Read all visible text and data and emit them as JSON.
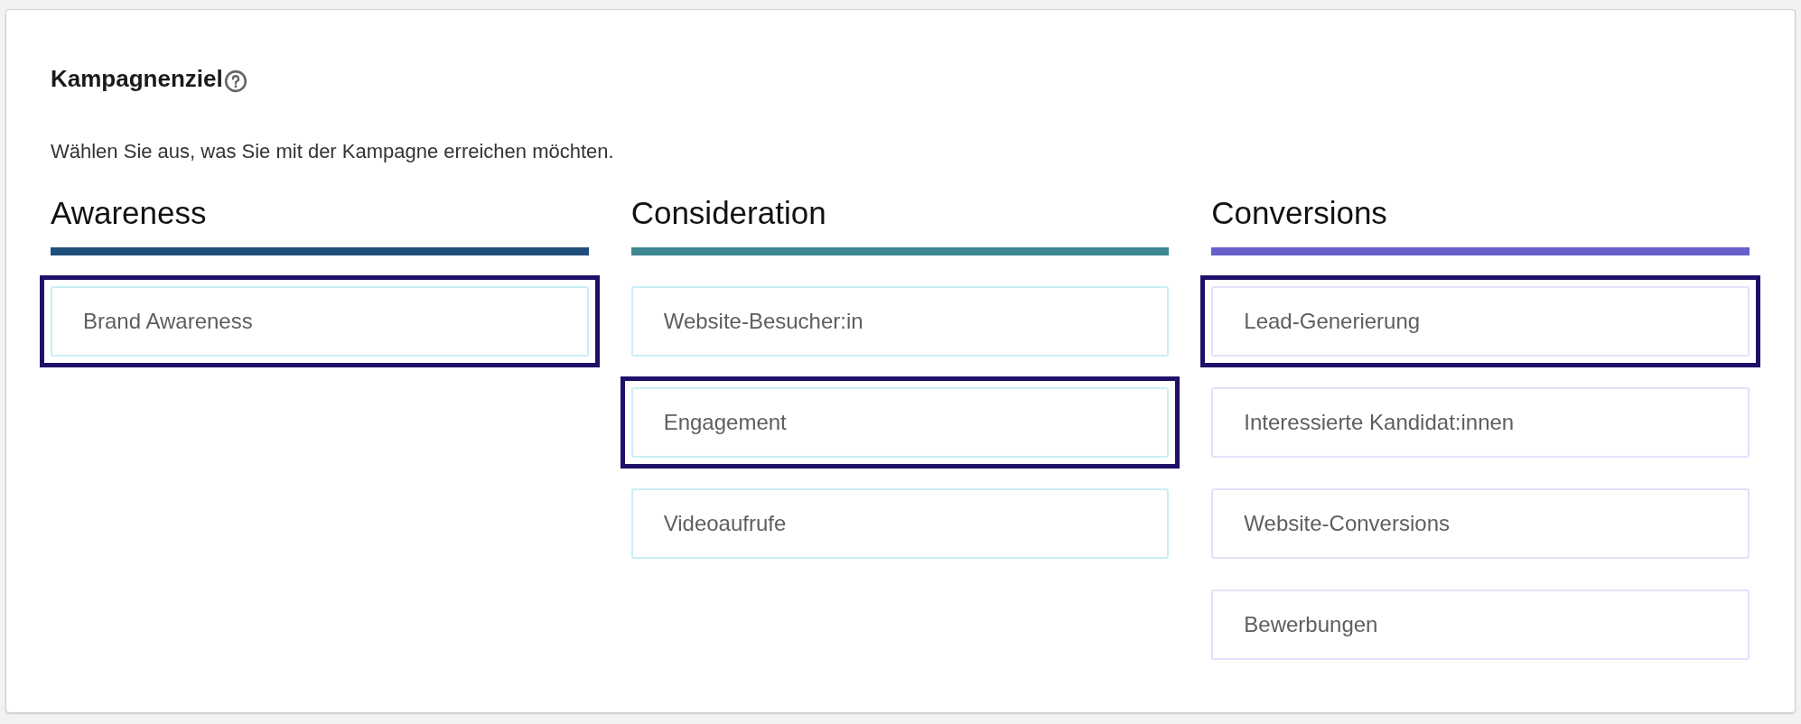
{
  "panel": {
    "title": "Kampagnenziel",
    "description": "Wählen Sie aus, was Sie mit der Kampagne erreichen möchten."
  },
  "columns": [
    {
      "heading": "Awareness",
      "color": "#1f4e7a",
      "options": [
        {
          "label": "Brand Awareness",
          "selected": true
        }
      ]
    },
    {
      "heading": "Consideration",
      "color": "#3d8891",
      "options": [
        {
          "label": "Website-Besucher:in",
          "selected": false
        },
        {
          "label": "Engagement",
          "selected": true
        },
        {
          "label": "Videoaufrufe",
          "selected": false
        }
      ]
    },
    {
      "heading": "Conversions",
      "color": "#6660c8",
      "options": [
        {
          "label": "Lead-Generierung",
          "selected": true
        },
        {
          "label": "Interessierte Kandidat:innen",
          "selected": false
        },
        {
          "label": "Website-Conversions",
          "selected": false
        },
        {
          "label": "Bewerbungen",
          "selected": false
        }
      ]
    }
  ]
}
